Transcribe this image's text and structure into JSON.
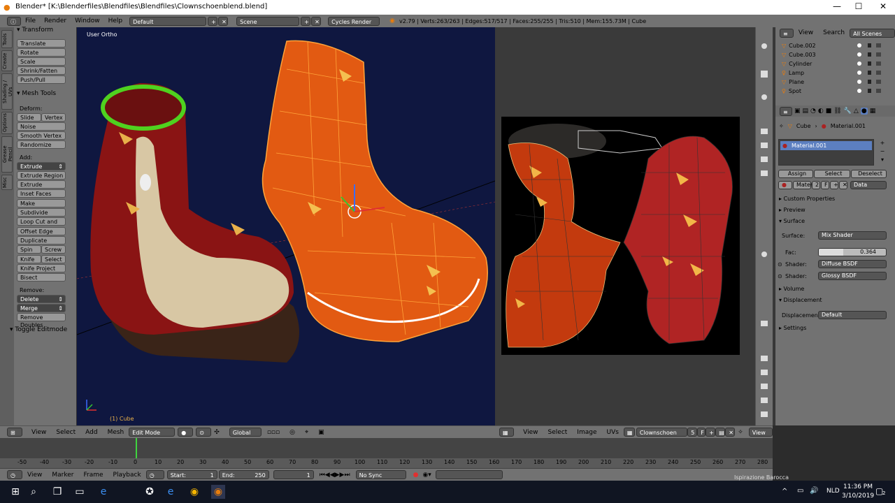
{
  "window": {
    "title": "Blender* [K:\\Blenderfiles\\Blendfiles\\Blendfiles\\Clownschoenblend.blend]",
    "minimize": "—",
    "maximize": "☐",
    "close": "✕"
  },
  "info": {
    "menus": [
      "File",
      "Render",
      "Window",
      "Help"
    ],
    "layout": "Default",
    "scene": "Scene",
    "engine": "Cycles Render",
    "stats": "v2.79 | Verts:263/263 | Edges:517/517 | Faces:255/255 | Tris:510 | Mem:155.73M | Cube"
  },
  "toolshelf": {
    "tabs": [
      "Tools",
      "Create",
      "Shading / UVs",
      "Options",
      "Grease Pencil",
      "Misc"
    ],
    "transform_header": "▾ Transform",
    "transform": [
      "Translate",
      "Rotate",
      "Scale",
      "Shrink/Fatten",
      "Push/Pull"
    ],
    "mesh_tools_header": "▾ Mesh Tools",
    "deform_label": "Deform:",
    "slide_edge": "Slide Ed",
    "vertex": "Vertex",
    "noise": "Noise",
    "smooth_vertex": "Smooth Vertex",
    "randomize": "Randomize",
    "add_label": "Add:",
    "extrude": "Extrude",
    "extrude_region": "Extrude Region",
    "extrude_individual": "Extrude Individual",
    "inset_faces": "Inset Faces",
    "make_edge_face": "Make Edge/Face",
    "subdivide": "Subdivide",
    "loop_cut": "Loop Cut and Slide",
    "offset_edge": "Offset Edge Slide",
    "duplicate": "Duplicate",
    "spin": "Spin",
    "screw": "Screw",
    "knife": "Knife",
    "select": "Select",
    "knife_project": "Knife Project",
    "bisect": "Bisect",
    "remove_label": "Remove:",
    "delete": "Delete",
    "merge": "Merge",
    "remove_doubles": "Remove Doubles",
    "toggle_editmode": "▾ Toggle Editmode"
  },
  "viewport": {
    "view_label": "User Ortho",
    "object_label": "(1) Cube"
  },
  "header3d": {
    "menus": [
      "View",
      "Select",
      "Add",
      "Mesh"
    ],
    "mode": "Edit Mode",
    "orientation": "Global"
  },
  "headeruv": {
    "menus": [
      "View",
      "Select",
      "Image",
      "UVs"
    ],
    "image": "Clownschoen",
    "users": "5",
    "f": "F",
    "view": "View"
  },
  "outliner": {
    "menus": [
      "View",
      "Search"
    ],
    "filter": "All Scenes",
    "items": [
      "Cube.002",
      "Cube.003",
      "Cylinder",
      "Lamp",
      "Plane",
      "Spot"
    ]
  },
  "props": {
    "object": "Cube",
    "material": "Material.001",
    "slot": "Material.001",
    "assign": "Assign",
    "select": "Select",
    "deselect": "Deselect",
    "mat_field": "Mater",
    "mat_users": "2",
    "mat_f": "F",
    "link": "Data",
    "custom_props": "▸ Custom Properties",
    "preview": "▸ Preview",
    "surface": "▾ Surface",
    "surface_label": "Surface:",
    "surface_val": "Mix Shader",
    "fac_label": "Fac:",
    "fac_val": "0.364",
    "fac": 0.364,
    "shader_label": "Shader:",
    "shader1": "Diffuse BSDF",
    "shader2": "Glossy BSDF",
    "volume": "▸ Volume",
    "displacement": "▾ Displacement",
    "disp_label": "Displacement:",
    "disp_val": "Default",
    "settings": "▸ Settings"
  },
  "timeline": {
    "ticks": [
      "-50",
      "-40",
      "-30",
      "-20",
      "-10",
      "0",
      "10",
      "20",
      "30",
      "40",
      "50",
      "60",
      "70",
      "80",
      "90",
      "100",
      "110",
      "120",
      "130",
      "140",
      "150",
      "160",
      "170",
      "180",
      "190",
      "200",
      "210",
      "220",
      "230",
      "240",
      "250",
      "260",
      "270",
      "280"
    ],
    "menus": [
      "View",
      "Marker",
      "Frame",
      "Playback"
    ],
    "start_label": "Start:",
    "start": "1",
    "end_label": "End:",
    "end": "250",
    "current": "1",
    "sync": "No Sync"
  },
  "taskbar": {
    "lang": "NLD",
    "time": "11:36 PM",
    "date": "3/10/2019",
    "notif": "2",
    "partial_window": "Ispirazione Barocca"
  }
}
